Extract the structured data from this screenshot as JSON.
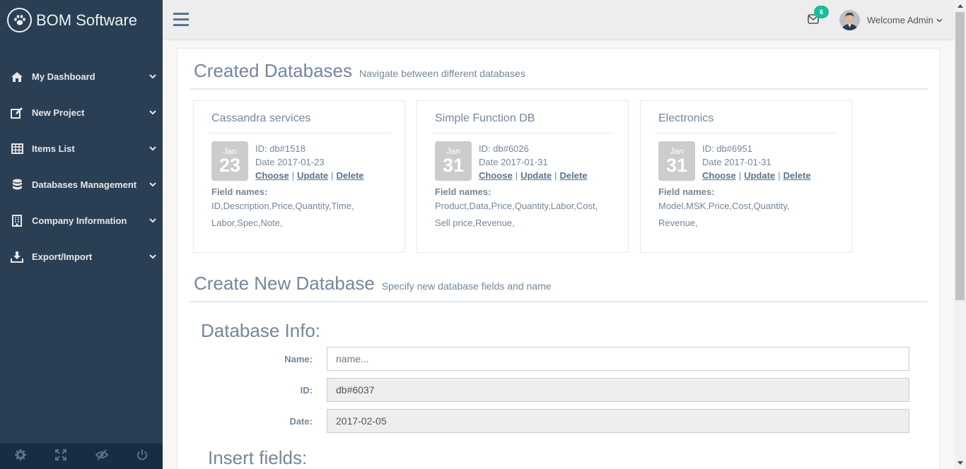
{
  "app": {
    "brand": "BOM Software"
  },
  "sidebar": {
    "items": [
      {
        "label": "My Dashboard",
        "icon": "home-icon"
      },
      {
        "label": "New Project",
        "icon": "edit-icon"
      },
      {
        "label": "Items List",
        "icon": "table-icon"
      },
      {
        "label": "Databases Management",
        "icon": "database-icon"
      },
      {
        "label": "Company Information",
        "icon": "building-icon"
      },
      {
        "label": "Export/Import",
        "icon": "download-icon"
      }
    ],
    "footer": [
      "settings-icon",
      "fullscreen-icon",
      "eye-slash-icon",
      "power-icon"
    ]
  },
  "topnav": {
    "mail_count": "6",
    "welcome": "Welcome Admin"
  },
  "created": {
    "title": "Created Databases",
    "subtitle": "Navigate between different databases",
    "field_names_label": "Field names:",
    "links": {
      "choose": "Choose",
      "update": "Update",
      "delete": "Delete",
      "sep": "|"
    },
    "cards": [
      {
        "name": "Cassandra services",
        "month": "Jan",
        "day": "23",
        "id": "ID: db#1518",
        "date": "Date 2017-01-23",
        "fields": "ID,Description,Price,Quantity,Time,\nLabor,Spec,Note,"
      },
      {
        "name": "Simple Function DB",
        "month": "Jan",
        "day": "31",
        "id": "ID: db#6026",
        "date": "Date 2017-01-31",
        "fields": "Product,Data,Price,Quantity,Labor,Cost,\nSell price,Revenue,"
      },
      {
        "name": "Electronics",
        "month": "Jan",
        "day": "31",
        "id": "ID: db#6951",
        "date": "Date 2017-01-31",
        "fields": "Model,MSK,Price,Cost,Quantity,\nRevenue,"
      }
    ]
  },
  "create": {
    "title": "Create New Database",
    "subtitle": "Specify new database fields and name",
    "info_heading": "Database Info:",
    "name_label": "Name:",
    "name_placeholder": "name...",
    "id_label": "ID:",
    "id_value": "db#6037",
    "date_label": "Date:",
    "date_value": "2017-02-05",
    "insert_heading": "Insert fields:"
  },
  "colors": {
    "sidebar": "#2a3f54",
    "accent": "#1abb9c",
    "text": "#73879c"
  }
}
